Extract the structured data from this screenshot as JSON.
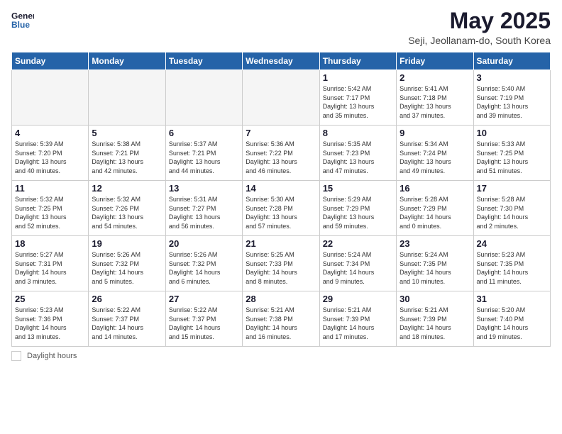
{
  "header": {
    "logo_line1": "General",
    "logo_line2": "Blue",
    "month_title": "May 2025",
    "subtitle": "Seji, Jeollanam-do, South Korea"
  },
  "days_of_week": [
    "Sunday",
    "Monday",
    "Tuesday",
    "Wednesday",
    "Thursday",
    "Friday",
    "Saturday"
  ],
  "footer": {
    "daylight_label": "Daylight hours"
  },
  "weeks": [
    [
      {
        "day": "",
        "info": ""
      },
      {
        "day": "",
        "info": ""
      },
      {
        "day": "",
        "info": ""
      },
      {
        "day": "",
        "info": ""
      },
      {
        "day": "1",
        "info": "Sunrise: 5:42 AM\nSunset: 7:17 PM\nDaylight: 13 hours\nand 35 minutes."
      },
      {
        "day": "2",
        "info": "Sunrise: 5:41 AM\nSunset: 7:18 PM\nDaylight: 13 hours\nand 37 minutes."
      },
      {
        "day": "3",
        "info": "Sunrise: 5:40 AM\nSunset: 7:19 PM\nDaylight: 13 hours\nand 39 minutes."
      }
    ],
    [
      {
        "day": "4",
        "info": "Sunrise: 5:39 AM\nSunset: 7:20 PM\nDaylight: 13 hours\nand 40 minutes."
      },
      {
        "day": "5",
        "info": "Sunrise: 5:38 AM\nSunset: 7:21 PM\nDaylight: 13 hours\nand 42 minutes."
      },
      {
        "day": "6",
        "info": "Sunrise: 5:37 AM\nSunset: 7:21 PM\nDaylight: 13 hours\nand 44 minutes."
      },
      {
        "day": "7",
        "info": "Sunrise: 5:36 AM\nSunset: 7:22 PM\nDaylight: 13 hours\nand 46 minutes."
      },
      {
        "day": "8",
        "info": "Sunrise: 5:35 AM\nSunset: 7:23 PM\nDaylight: 13 hours\nand 47 minutes."
      },
      {
        "day": "9",
        "info": "Sunrise: 5:34 AM\nSunset: 7:24 PM\nDaylight: 13 hours\nand 49 minutes."
      },
      {
        "day": "10",
        "info": "Sunrise: 5:33 AM\nSunset: 7:25 PM\nDaylight: 13 hours\nand 51 minutes."
      }
    ],
    [
      {
        "day": "11",
        "info": "Sunrise: 5:32 AM\nSunset: 7:25 PM\nDaylight: 13 hours\nand 52 minutes."
      },
      {
        "day": "12",
        "info": "Sunrise: 5:32 AM\nSunset: 7:26 PM\nDaylight: 13 hours\nand 54 minutes."
      },
      {
        "day": "13",
        "info": "Sunrise: 5:31 AM\nSunset: 7:27 PM\nDaylight: 13 hours\nand 56 minutes."
      },
      {
        "day": "14",
        "info": "Sunrise: 5:30 AM\nSunset: 7:28 PM\nDaylight: 13 hours\nand 57 minutes."
      },
      {
        "day": "15",
        "info": "Sunrise: 5:29 AM\nSunset: 7:29 PM\nDaylight: 13 hours\nand 59 minutes."
      },
      {
        "day": "16",
        "info": "Sunrise: 5:28 AM\nSunset: 7:29 PM\nDaylight: 14 hours\nand 0 minutes."
      },
      {
        "day": "17",
        "info": "Sunrise: 5:28 AM\nSunset: 7:30 PM\nDaylight: 14 hours\nand 2 minutes."
      }
    ],
    [
      {
        "day": "18",
        "info": "Sunrise: 5:27 AM\nSunset: 7:31 PM\nDaylight: 14 hours\nand 3 minutes."
      },
      {
        "day": "19",
        "info": "Sunrise: 5:26 AM\nSunset: 7:32 PM\nDaylight: 14 hours\nand 5 minutes."
      },
      {
        "day": "20",
        "info": "Sunrise: 5:26 AM\nSunset: 7:32 PM\nDaylight: 14 hours\nand 6 minutes."
      },
      {
        "day": "21",
        "info": "Sunrise: 5:25 AM\nSunset: 7:33 PM\nDaylight: 14 hours\nand 8 minutes."
      },
      {
        "day": "22",
        "info": "Sunrise: 5:24 AM\nSunset: 7:34 PM\nDaylight: 14 hours\nand 9 minutes."
      },
      {
        "day": "23",
        "info": "Sunrise: 5:24 AM\nSunset: 7:35 PM\nDaylight: 14 hours\nand 10 minutes."
      },
      {
        "day": "24",
        "info": "Sunrise: 5:23 AM\nSunset: 7:35 PM\nDaylight: 14 hours\nand 11 minutes."
      }
    ],
    [
      {
        "day": "25",
        "info": "Sunrise: 5:23 AM\nSunset: 7:36 PM\nDaylight: 14 hours\nand 13 minutes."
      },
      {
        "day": "26",
        "info": "Sunrise: 5:22 AM\nSunset: 7:37 PM\nDaylight: 14 hours\nand 14 minutes."
      },
      {
        "day": "27",
        "info": "Sunrise: 5:22 AM\nSunset: 7:37 PM\nDaylight: 14 hours\nand 15 minutes."
      },
      {
        "day": "28",
        "info": "Sunrise: 5:21 AM\nSunset: 7:38 PM\nDaylight: 14 hours\nand 16 minutes."
      },
      {
        "day": "29",
        "info": "Sunrise: 5:21 AM\nSunset: 7:39 PM\nDaylight: 14 hours\nand 17 minutes."
      },
      {
        "day": "30",
        "info": "Sunrise: 5:21 AM\nSunset: 7:39 PM\nDaylight: 14 hours\nand 18 minutes."
      },
      {
        "day": "31",
        "info": "Sunrise: 5:20 AM\nSunset: 7:40 PM\nDaylight: 14 hours\nand 19 minutes."
      }
    ]
  ]
}
